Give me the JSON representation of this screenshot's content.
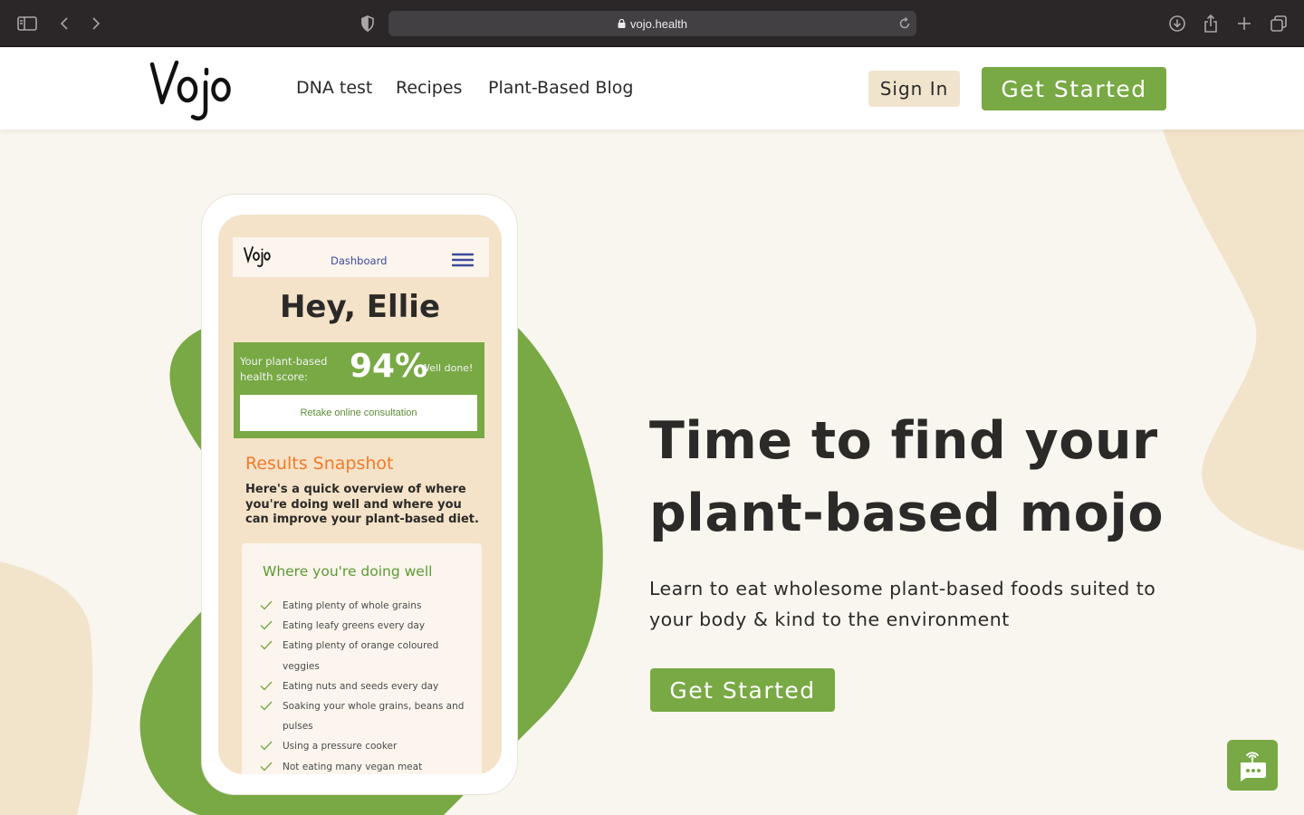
{
  "browser": {
    "url": "vojo.health",
    "icons": [
      "sidebar-icon",
      "back-icon",
      "forward-icon",
      "shield-icon",
      "lock-icon",
      "reload-icon",
      "download-icon",
      "share-icon",
      "new-tab-icon",
      "tabs-overview-icon"
    ]
  },
  "header": {
    "logo": "Vojo",
    "nav": [
      "DNA test",
      "Recipes",
      "Plant-Based Blog"
    ],
    "sign_in": "Sign In",
    "get_started": "Get Started"
  },
  "hero": {
    "title_line1": "Time to find your",
    "title_line2": "plant-based mojo",
    "subtitle_line1": "Learn to eat wholesome plant-based foods suited to",
    "subtitle_line2": "your body & kind to the environment",
    "cta": "Get Started"
  },
  "phone": {
    "logo": "Vojo",
    "nav_title": "Dashboard",
    "greeting": "Hey, Ellie",
    "score_label": "Your plant-based health score:",
    "score_value": "94%",
    "score_praise": "Well done!",
    "retake": "Retake online consultation",
    "snapshot_title": "Results Snapshot",
    "snapshot_desc": "Here's a quick overview of where you're doing well and where you can improve your plant-based diet.",
    "well_title": "Where you're doing well",
    "well_items": [
      "Eating plenty of whole grains",
      "Eating leafy greens every day",
      "Eating plenty of orange coloured veggies",
      "Eating nuts and seeds every day",
      "Soaking your whole grains, beans and pulses",
      "Using a pressure cooker",
      "Not eating many vegan meat"
    ]
  },
  "colors": {
    "brand_green": "#78a944",
    "cream": "#f9f5ef",
    "beige": "#f1e4cd",
    "accent_orange": "#f27a2b",
    "nav_blue": "#3d4a9a"
  },
  "chat": {
    "icon": "chat-bot-icon"
  }
}
